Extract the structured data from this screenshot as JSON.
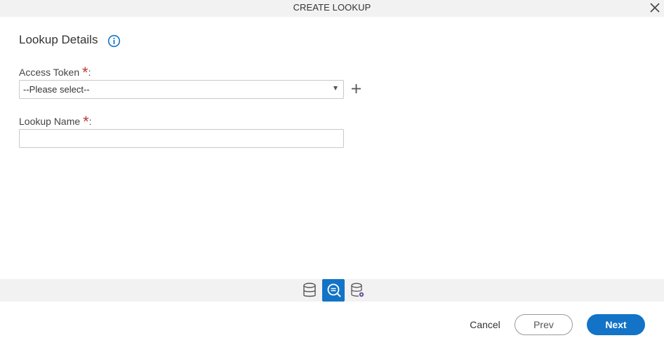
{
  "dialog": {
    "title": "CREATE LOOKUP",
    "close_icon": "close-icon"
  },
  "section": {
    "title": "Lookup Details",
    "info_icon": "info-icon"
  },
  "fields": {
    "access_token": {
      "label": "Access Token",
      "required_marker": "*",
      "suffix": ":",
      "value": "--Please select--",
      "add_icon": "plus-icon"
    },
    "lookup_name": {
      "label": "Lookup Name",
      "required_marker": "*",
      "suffix": ":",
      "value": ""
    }
  },
  "steps": [
    {
      "icon": "database-icon",
      "active": false
    },
    {
      "icon": "lookup-search-icon",
      "active": true
    },
    {
      "icon": "database-settings-icon",
      "active": false
    }
  ],
  "footer": {
    "cancel": "Cancel",
    "prev": "Prev",
    "next": "Next"
  },
  "colors": {
    "accent": "#1273c7",
    "required": "#b53a3a",
    "bar_bg": "#f2f2f2"
  }
}
